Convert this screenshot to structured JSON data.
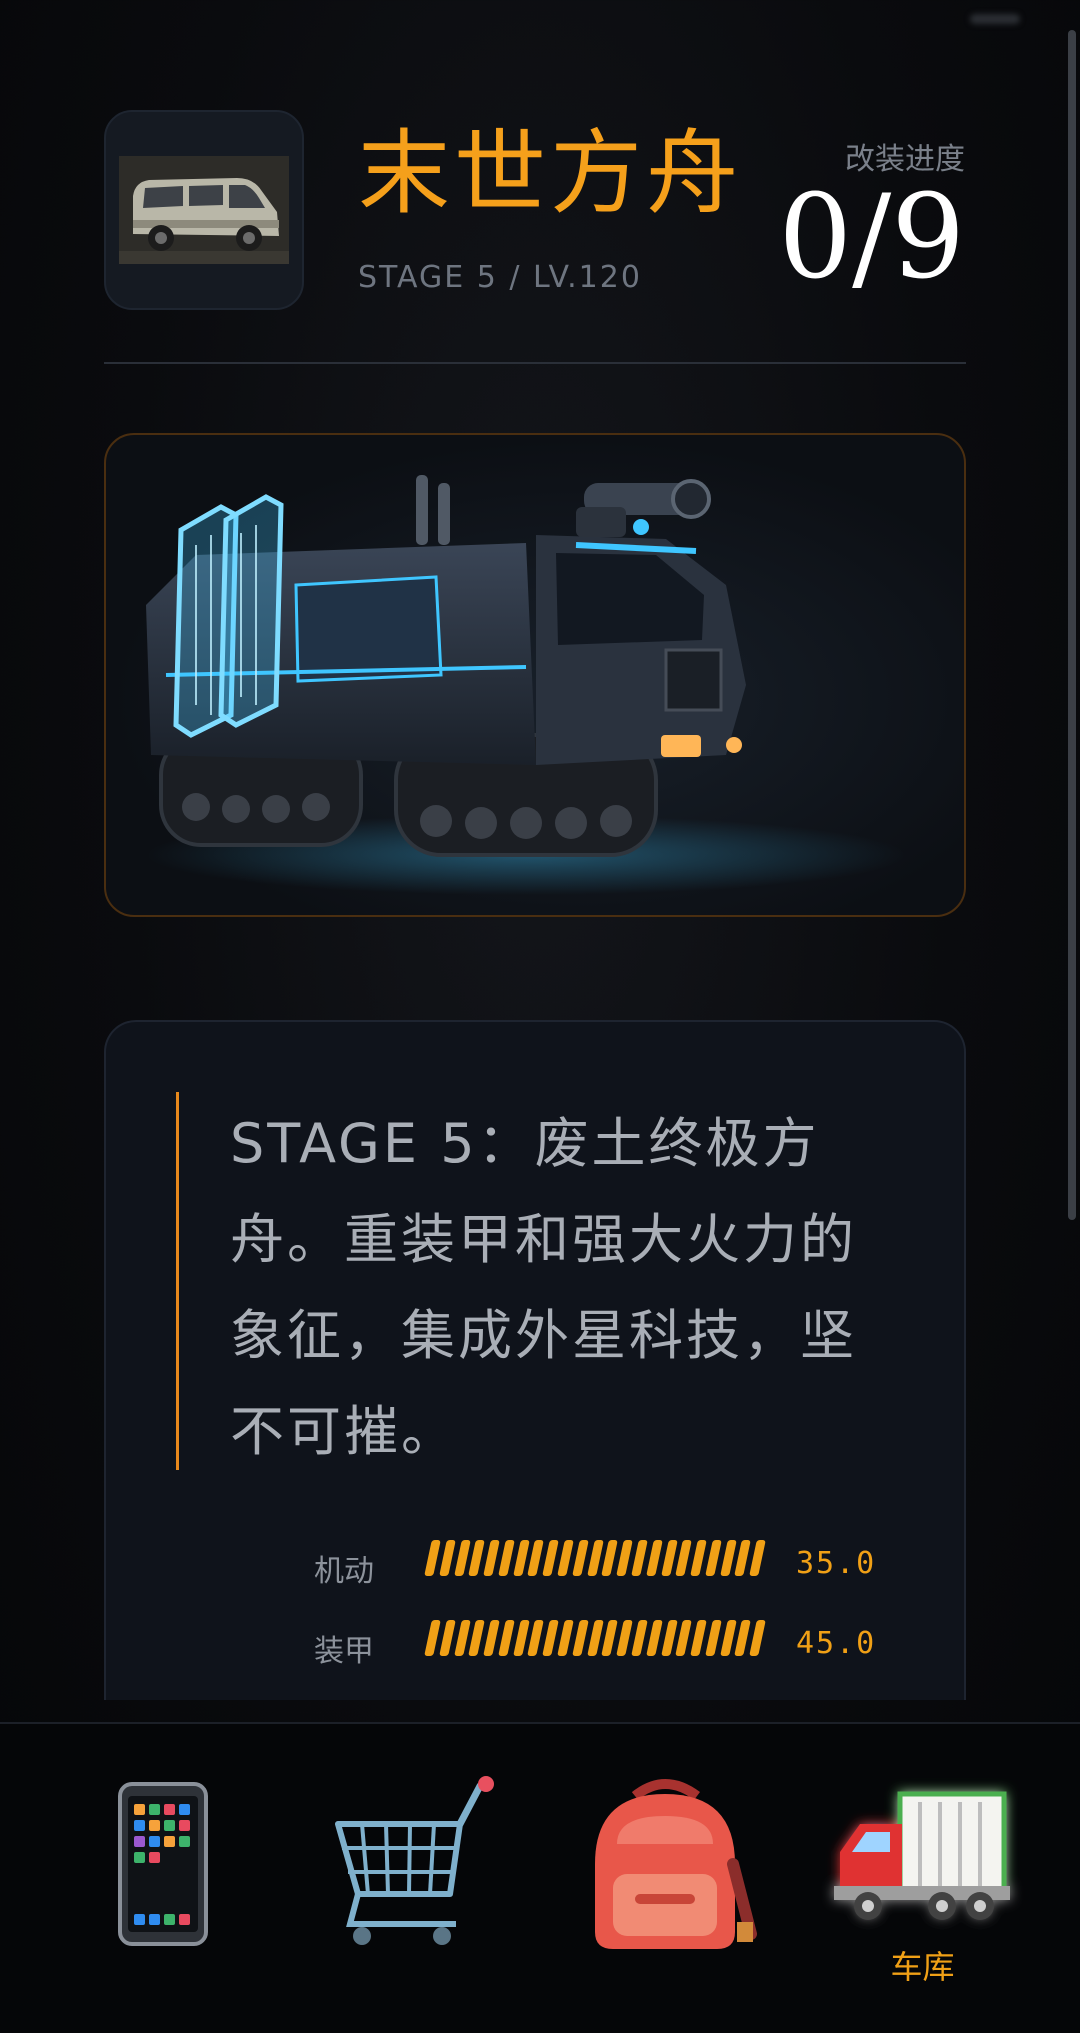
{
  "header": {
    "title": "末世方舟",
    "subtitle": "STAGE 5 / LV.120",
    "progress_label": "改装进度",
    "progress_value": "0/9"
  },
  "description": {
    "text": "STAGE 5：废土终极方舟。重装甲和强大火力的象征，集成外星科技，坚不可摧。"
  },
  "stats": [
    {
      "label": "机动",
      "value": "35.0"
    },
    {
      "label": "装甲",
      "value": "45.0"
    }
  ],
  "nav": {
    "items": [
      {
        "icon": "phone-icon",
        "label": ""
      },
      {
        "icon": "shopping-cart-icon",
        "label": ""
      },
      {
        "icon": "backpack-icon",
        "label": ""
      },
      {
        "icon": "truck-icon",
        "label": "车库",
        "active": true
      }
    ]
  },
  "colors": {
    "accent": "#f5a01b",
    "background": "#0a0b0e",
    "card": "#0f131b",
    "neon": "#3fc6ff"
  }
}
